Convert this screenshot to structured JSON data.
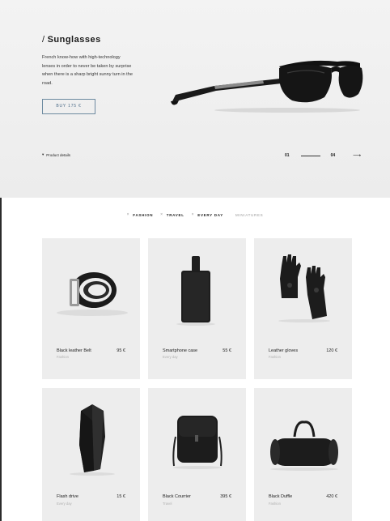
{
  "hero": {
    "slash": "/",
    "title": "Sunglasses",
    "description": "French know-how with high-technology lenses in order to never be taken by surprise when there is a sharp bright sunny turn in the road.",
    "buy_label": "BUY 175 €",
    "details_label": "Product details",
    "pager_current": "01",
    "pager_total": "04"
  },
  "filters": {
    "tabs": [
      {
        "label": "FASHION",
        "active": true
      },
      {
        "label": "TRAVEL",
        "active": true
      },
      {
        "label": "EVERY DAY",
        "active": true
      },
      {
        "label": "MINIATURES",
        "active": false
      }
    ]
  },
  "products": [
    {
      "name": "Black leather Belt",
      "price": "95 €",
      "category": "Fashion",
      "icon": "belt-icon"
    },
    {
      "name": "Smartphone case",
      "price": "55 €",
      "category": "Every day",
      "icon": "phone-case-icon"
    },
    {
      "name": "Leather gloves",
      "price": "120 €",
      "category": "Fashion",
      "icon": "gloves-icon"
    },
    {
      "name": "Flash drive",
      "price": "15 €",
      "category": "Every day",
      "icon": "flash-drive-icon"
    },
    {
      "name": "Black Courrier",
      "price": "395 €",
      "category": "Travel",
      "icon": "messenger-bag-icon"
    },
    {
      "name": "Black Duffle",
      "price": "420 €",
      "category": "Fashion",
      "icon": "duffle-bag-icon"
    }
  ],
  "colors": {
    "hero_bg": "#efefef",
    "card_bg": "#ededed",
    "button_border": "#6d8aa0",
    "muted_text": "#b0b0b0"
  }
}
